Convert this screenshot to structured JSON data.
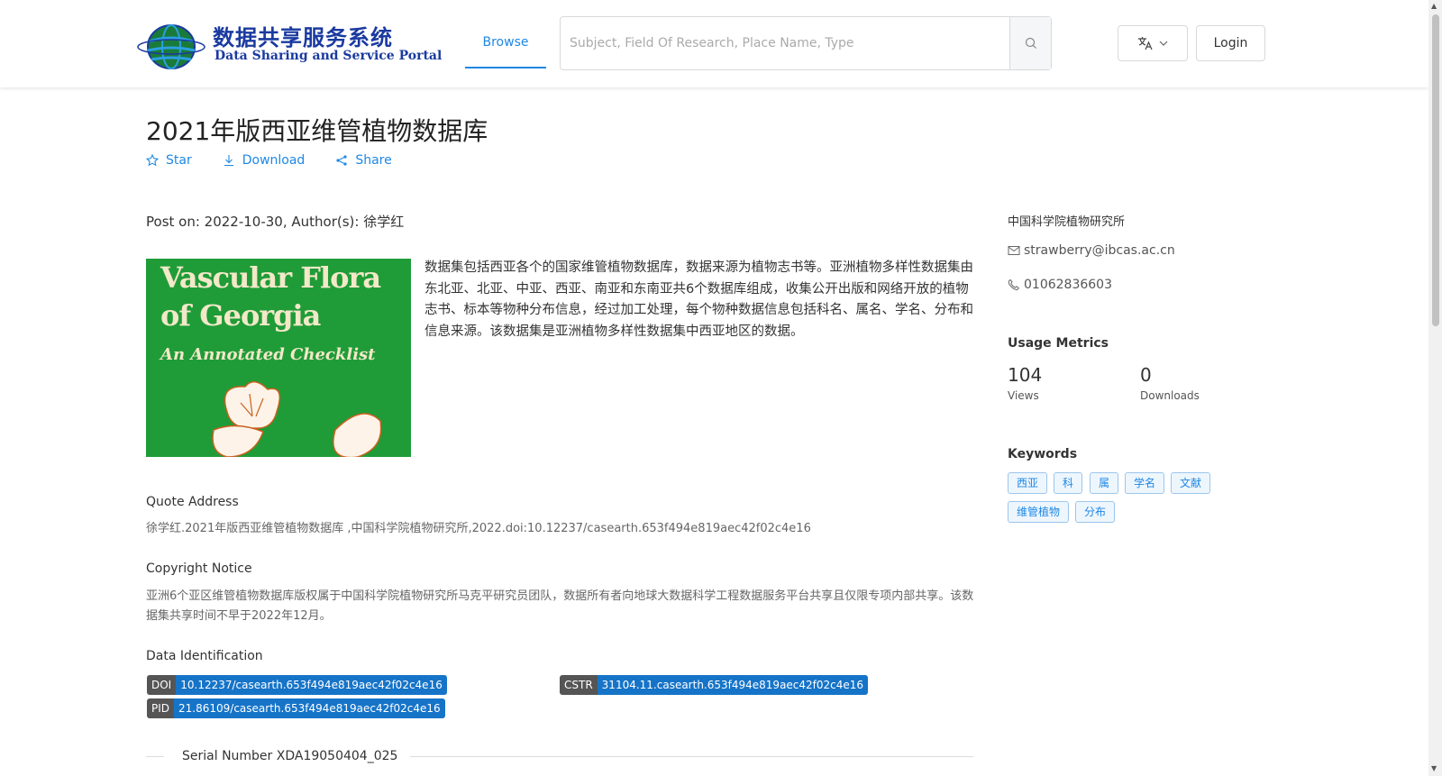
{
  "header": {
    "logo": {
      "text_cn": "数据共享服务系统",
      "text_en": "Data Sharing and Service Portal"
    },
    "nav_browse": "Browse",
    "search_placeholder": "Subject, Field Of Research, Place Name, Type",
    "login": "Login",
    "lang_icon": "translate-icon"
  },
  "dataset": {
    "title": "2021年版西亚维管植物数据库",
    "actions": {
      "star": "Star",
      "download": "Download",
      "share": "Share"
    },
    "post_line": "Post on: 2022-10-30, Author(s): 徐学红",
    "cover": {
      "line1": "Vascular Flora",
      "line2": "of Georgia",
      "line3": "An Annotated Checklist"
    },
    "description": "数据集包括西亚各个的国家维管植物数据库，数据来源为植物志书等。亚洲植物多样性数据集由东北亚、北亚、中亚、西亚、南亚和东南亚共6个数据库组成，收集公开出版和网络开放的植物志书、标本等物种分布信息，经过加工处理，每个物种数据信息包括科名、属名、学名、分布和信息来源。该数据集是亚洲植物多样性数据集中西亚地区的数据。",
    "quote": {
      "heading": "Quote Address",
      "text": "徐学红.2021年版西亚维管植物数据库 ,中国科学院植物研究所,2022.doi:10.12237/casearth.653f494e819aec42f02c4e16"
    },
    "copyright": {
      "heading": "Copyright Notice",
      "text": "亚洲6个亚区维管植物数据库版权属于中国科学院植物研究所马克平研究员团队，数据所有者向地球大数据科学工程数据服务平台共享且仅限专项内部共享。该数据集共享时间不早于2022年12月。"
    },
    "identification": {
      "heading": "Data Identification",
      "doi": {
        "key": "DOI",
        "value": "10.12237/casearth.653f494e819aec42f02c4e16"
      },
      "cstr": {
        "key": "CSTR",
        "value": "31104.11.casearth.653f494e819aec42f02c4e16"
      },
      "pid": {
        "key": "PID",
        "value": "21.86109/casearth.653f494e819aec42f02c4e16"
      }
    },
    "serial": "Serial Number XDA19050404_025"
  },
  "sidebar": {
    "org": "中国科学院植物研究所",
    "email": "strawberry@ibcas.ac.cn",
    "phone": "01062836603",
    "metrics_heading": "Usage Metrics",
    "views": {
      "value": "104",
      "label": "Views"
    },
    "downloads": {
      "value": "0",
      "label": "Downloads"
    },
    "keywords_heading": "Keywords",
    "keywords": [
      "西亚",
      "科",
      "属",
      "学名",
      "文献",
      "维管植物",
      "分布"
    ]
  },
  "colors": {
    "accent": "#1e88e5",
    "tag_key": "#555555",
    "tag_value": "#1674c8",
    "cover_green": "#1f9c38"
  }
}
